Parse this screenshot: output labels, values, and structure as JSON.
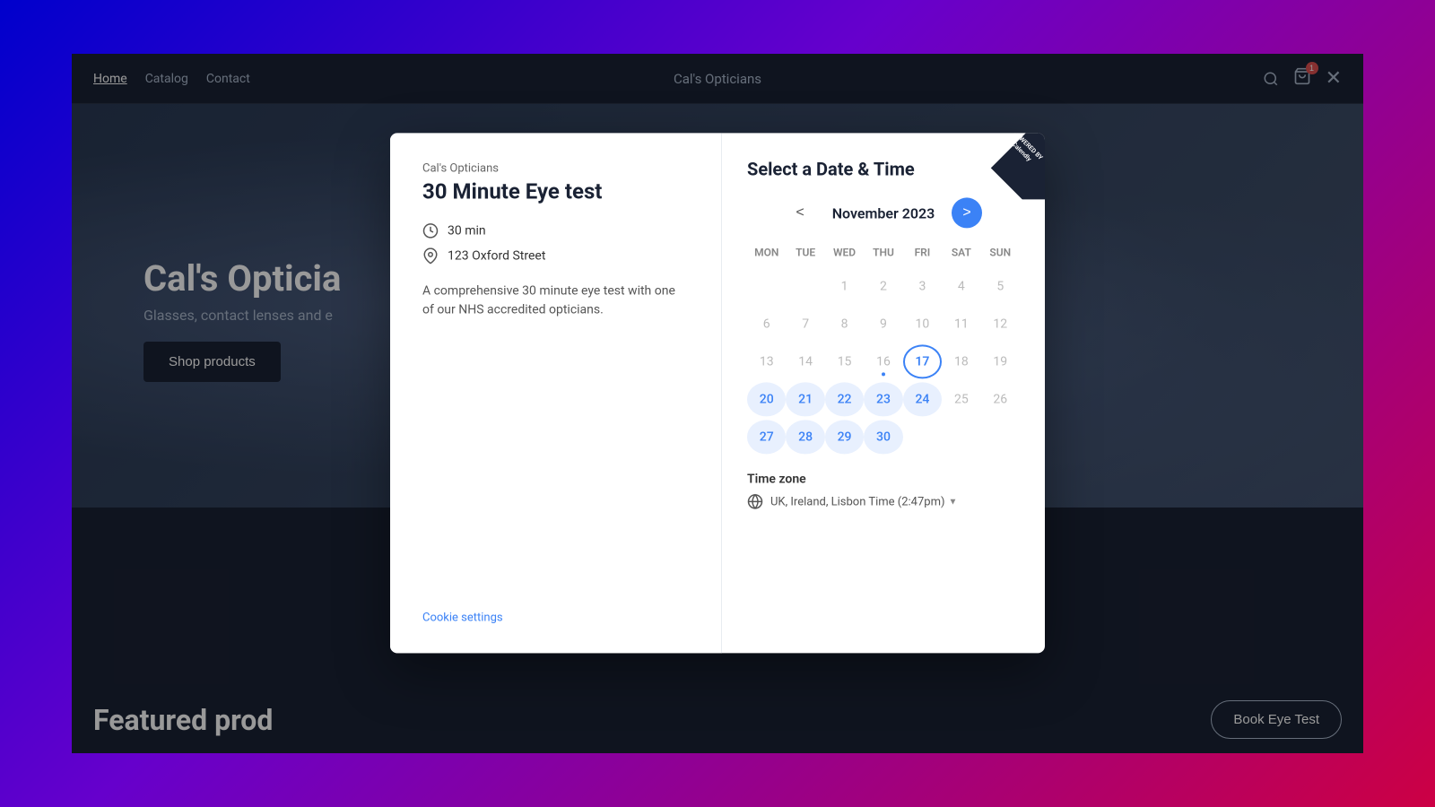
{
  "background": {
    "gradient": "linear-gradient(135deg, #0000cc, #6600cc, #cc0066)"
  },
  "navbar": {
    "links": [
      {
        "label": "Home",
        "active": true
      },
      {
        "label": "Catalog",
        "active": false
      },
      {
        "label": "Contact",
        "active": false
      }
    ],
    "site_title": "Cal's Opticians",
    "search_label": "search",
    "cart_label": "cart",
    "cart_count": "1",
    "close_label": "close"
  },
  "hero": {
    "title": "Cal's Opticia",
    "subtitle": "Glasses, contact lenses and e",
    "cta_button": "Shop products"
  },
  "bottom_bar": {
    "featured_label": "Featured prod",
    "book_button": "Book Eye Test"
  },
  "modal": {
    "org_name": "Cal's Opticians",
    "title": "30 Minute Eye test",
    "duration": "30 min",
    "location": "123 Oxford Street",
    "description": "A comprehensive 30 minute eye test with one of our NHS accredited opticians.",
    "cookie_settings": "Cookie settings",
    "calendar_header": "Select a Date & Time",
    "month_label": "November 2023",
    "days_of_week": [
      "MON",
      "TUE",
      "WED",
      "THU",
      "FRI",
      "SAT",
      "SUN"
    ],
    "weeks": [
      [
        null,
        null,
        1,
        2,
        3,
        4,
        5
      ],
      [
        6,
        7,
        8,
        9,
        10,
        11,
        12
      ],
      [
        13,
        14,
        15,
        16,
        17,
        18,
        19
      ],
      [
        20,
        21,
        22,
        23,
        24,
        25,
        26
      ],
      [
        27,
        28,
        29,
        30,
        null,
        null,
        null
      ]
    ],
    "available_days": [
      20,
      21,
      22,
      23,
      24,
      27,
      28,
      29,
      30
    ],
    "today_day": 17,
    "has_dot_day": 16,
    "timezone_label": "Time zone",
    "timezone_value": "UK, Ireland, Lisbon Time (2:47pm)",
    "calendly_badge_line1": "POWERED BY",
    "calendly_badge_line2": "Calendly",
    "prev_btn_label": "<",
    "next_btn_label": ">"
  }
}
